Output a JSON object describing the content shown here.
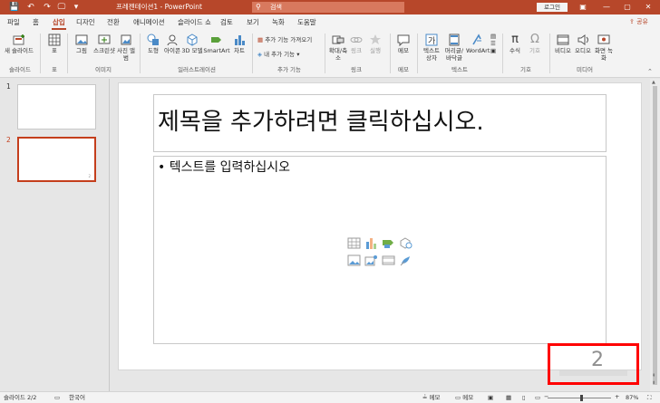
{
  "titlebar": {
    "doc_title": "프레젠테이션1 - PowerPoint",
    "search_placeholder": "검색",
    "login_label": "로그인",
    "minimize": "—",
    "restore": "▢",
    "close": "✕",
    "quick_access": {
      "save": "💾",
      "undo": "↶",
      "redo": "↷",
      "present": "🖵",
      "customize": "▾"
    }
  },
  "tabs": [
    "파일",
    "홈",
    "삽입",
    "디자인",
    "전환",
    "애니메이션",
    "슬라이드 쇼",
    "검토",
    "보기",
    "녹화",
    "도움말"
  ],
  "active_tab": "삽입",
  "share_label": "공유",
  "ribbon": {
    "new_slide": "새 슬라이드",
    "table": "표",
    "image": "그림",
    "screenshot": "스크린샷",
    "photo_album": "사진 앨범",
    "shapes": "도형",
    "icons": "아이콘",
    "models_3d": "3D 모델",
    "smartart": "SmartArt",
    "chart": "차트",
    "get_addins": "추가 기능 가져오기",
    "my_addins": "내 추가 기능",
    "zoom": "확대/축소",
    "link": "링크",
    "action": "실행",
    "comment": "메모",
    "textbox": "텍스트 상자",
    "header_footer": "머리글/바닥글",
    "wordart": "WordArt",
    "equation": "수식",
    "symbol": "기호",
    "video": "비디오",
    "audio": "오디오",
    "screen_recording": "화면 녹화",
    "groups": {
      "slides": "슬라이드",
      "tables": "표",
      "images": "이미지",
      "illustrations": "일러스트레이션",
      "addins": "추가 기능",
      "links": "링크",
      "comments": "메모",
      "text": "텍스트",
      "symbols": "기호",
      "media": "미디어"
    }
  },
  "thumbnails": [
    {
      "number": "1"
    },
    {
      "number": "2"
    }
  ],
  "slide": {
    "title_placeholder": "제목을 추가하려면 클릭하십시오.",
    "content_placeholder": "• 텍스트를 입력하십시오",
    "slide_number": "2"
  },
  "statusbar": {
    "slide_info": "슬라이드 2/2",
    "language": "한국어",
    "notes": "메모",
    "comments": "메모",
    "zoom_level": "87%"
  },
  "colors": {
    "accent": "#b7472a",
    "selection": "#c43e1c",
    "highlight": "#ff0000"
  }
}
